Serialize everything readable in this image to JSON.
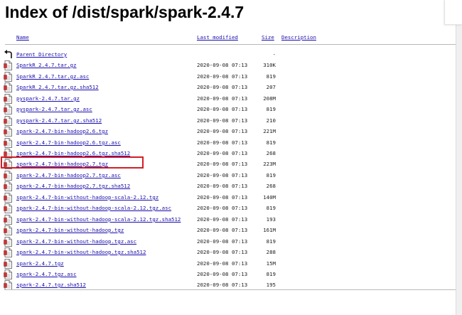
{
  "page": {
    "title": "Index of /dist/spark/spark-2.4.7",
    "accent_color": "#d21f26",
    "link_color": "#1a0dab"
  },
  "headers": {
    "name": "Name",
    "last_modified": "Last modified",
    "size": "Size",
    "description": "Description"
  },
  "rows": [
    {
      "icon": "back-icon",
      "name": "Parent Directory",
      "modified": "",
      "size": "-"
    },
    {
      "icon": "file-icon",
      "name": "SparkR_2.4.7.tar.gz",
      "modified": "2020-09-08 07:13",
      "size": "310K"
    },
    {
      "icon": "file-icon",
      "name": "SparkR_2.4.7.tar.gz.asc",
      "modified": "2020-09-08 07:13",
      "size": "819"
    },
    {
      "icon": "file-icon",
      "name": "SparkR_2.4.7.tar.gz.sha512",
      "modified": "2020-09-08 07:13",
      "size": "207"
    },
    {
      "icon": "file-icon",
      "name": "pyspark-2.4.7.tar.gz",
      "modified": "2020-09-08 07:13",
      "size": "208M"
    },
    {
      "icon": "file-icon",
      "name": "pyspark-2.4.7.tar.gz.asc",
      "modified": "2020-09-08 07:13",
      "size": "819"
    },
    {
      "icon": "file-icon",
      "name": "pyspark-2.4.7.tar.gz.sha512",
      "modified": "2020-09-08 07:13",
      "size": "210"
    },
    {
      "icon": "file-icon",
      "name": "spark-2.4.7-bin-hadoop2.6.tgz",
      "modified": "2020-09-08 07:13",
      "size": "221M"
    },
    {
      "icon": "file-icon",
      "name": "spark-2.4.7-bin-hadoop2.6.tgz.asc",
      "modified": "2020-09-08 07:13",
      "size": "819"
    },
    {
      "icon": "file-icon",
      "name": "spark-2.4.7-bin-hadoop2.6.tgz.sha512",
      "modified": "2020-09-08 07:13",
      "size": "268"
    },
    {
      "icon": "file-icon",
      "name": "spark-2.4.7-bin-hadoop2.7.tgz",
      "modified": "2020-09-08 07:13",
      "size": "223M"
    },
    {
      "icon": "file-icon",
      "name": "spark-2.4.7-bin-hadoop2.7.tgz.asc",
      "modified": "2020-09-08 07:13",
      "size": "819"
    },
    {
      "icon": "file-icon",
      "name": "spark-2.4.7-bin-hadoop2.7.tgz.sha512",
      "modified": "2020-09-08 07:13",
      "size": "268"
    },
    {
      "icon": "file-icon",
      "name": "spark-2.4.7-bin-without-hadoop-scala-2.12.tgz",
      "modified": "2020-09-08 07:13",
      "size": "140M"
    },
    {
      "icon": "file-icon",
      "name": "spark-2.4.7-bin-without-hadoop-scala-2.12.tgz.asc",
      "modified": "2020-09-08 07:13",
      "size": "819"
    },
    {
      "icon": "file-icon",
      "name": "spark-2.4.7-bin-without-hadoop-scala-2.12.tgz.sha512",
      "modified": "2020-09-08 07:13",
      "size": "193"
    },
    {
      "icon": "file-icon",
      "name": "spark-2.4.7-bin-without-hadoop.tgz",
      "modified": "2020-09-08 07:13",
      "size": "161M"
    },
    {
      "icon": "file-icon",
      "name": "spark-2.4.7-bin-without-hadoop.tgz.asc",
      "modified": "2020-09-08 07:13",
      "size": "819"
    },
    {
      "icon": "file-icon",
      "name": "spark-2.4.7-bin-without-hadoop.tgz.sha512",
      "modified": "2020-09-08 07:13",
      "size": "288"
    },
    {
      "icon": "file-icon",
      "name": "spark-2.4.7.tgz",
      "modified": "2020-09-08 07:13",
      "size": "15M"
    },
    {
      "icon": "file-icon",
      "name": "spark-2.4.7.tgz.asc",
      "modified": "2020-09-08 07:13",
      "size": "819"
    },
    {
      "icon": "file-icon",
      "name": "spark-2.4.7.tgz.sha512",
      "modified": "2020-09-08 07:13",
      "size": "195"
    }
  ]
}
